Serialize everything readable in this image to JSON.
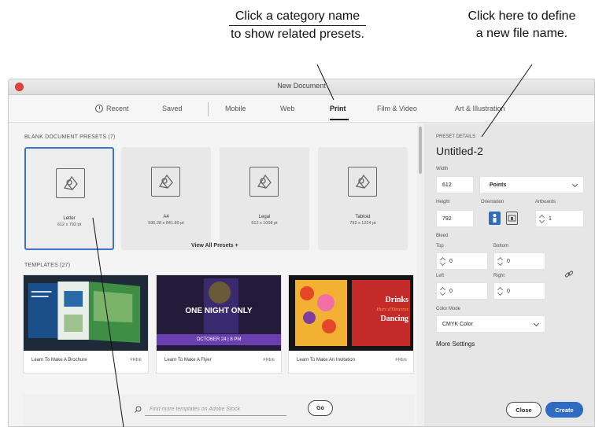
{
  "callouts": {
    "left_line1": "Click a category name",
    "left_line2": "to show related presets.",
    "right_line1": "Click here to define",
    "right_line2": "a new file name."
  },
  "window": {
    "title": "New Document"
  },
  "tabs": [
    {
      "label": "Recent"
    },
    {
      "label": "Saved"
    },
    {
      "label": "Mobile"
    },
    {
      "label": "Web"
    },
    {
      "label": "Print",
      "active": true
    },
    {
      "label": "Film & Video"
    },
    {
      "label": "Art & Illustration"
    }
  ],
  "presets_section": {
    "heading": "BLANK DOCUMENT PRESETS (7)",
    "items": [
      {
        "name": "Letter",
        "size": "612 x 792 pt",
        "selected": true
      },
      {
        "name": "A4",
        "size": "595.28 x 841.89 pt"
      },
      {
        "name": "Legal",
        "size": "612 x 1008 pt"
      },
      {
        "name": "Tabloid",
        "size": "792 x 1224 pt"
      }
    ],
    "view_all": "View All Presets +"
  },
  "templates_section": {
    "heading": "TEMPLATES (27)",
    "items": [
      {
        "name": "Learn To Make A Brochure",
        "badge": "FREE"
      },
      {
        "name": "Learn To Make A Flyer",
        "badge": "FREE",
        "art_line1": "ONE NIGHT ONLY",
        "art_line2": "OCTOBER 24 | 8 PM"
      },
      {
        "name": "Learn To Make An Invitation",
        "badge": "FREE",
        "art_line1": "Drinks",
        "art_line2": "Hors d'Oeuvres",
        "art_line3": "Dancing"
      }
    ]
  },
  "stock_search": {
    "placeholder": "Find more templates on Adobe Stock",
    "go_label": "Go"
  },
  "preset_details": {
    "heading": "PRESET DETAILS",
    "doc_name": "Untitled-2",
    "width_label": "Width",
    "width_value": "612",
    "units_value": "Points",
    "height_label": "Height",
    "height_value": "792",
    "orientation_label": "Orientation",
    "artboards_label": "Artboards",
    "artboards_value": "1",
    "bleed_label": "Bleed",
    "top_label": "Top",
    "top_value": "0",
    "bottom_label": "Bottom",
    "bottom_value": "0",
    "left_label": "Left",
    "left_value": "0",
    "right_label": "Right",
    "right_value": "0",
    "color_mode_label": "Color Mode",
    "color_mode_value": "CMYK Color",
    "more_settings": "More Settings",
    "close_label": "Close",
    "create_label": "Create"
  },
  "colors": {
    "accent": "#2d6cc0",
    "close_dot": "#e0443e"
  }
}
